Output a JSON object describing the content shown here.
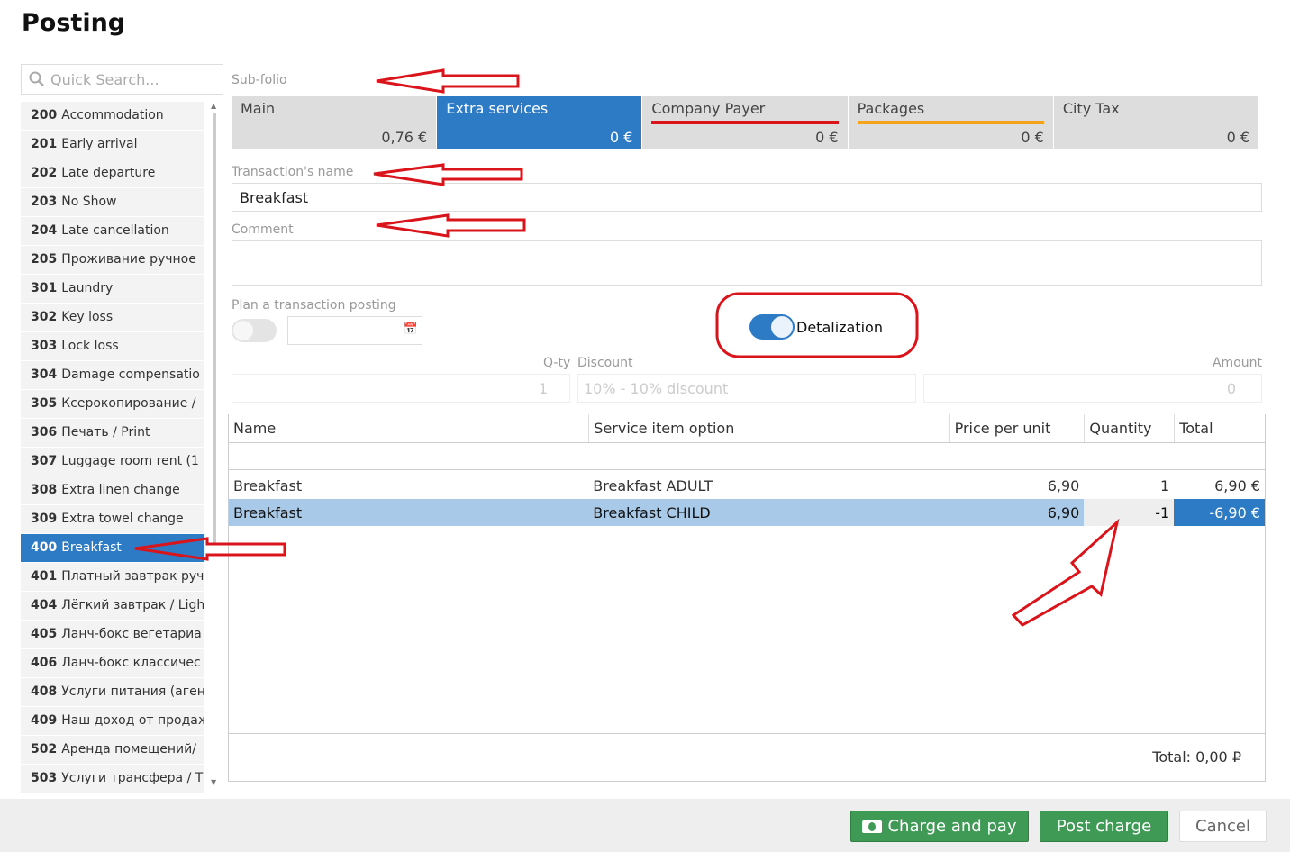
{
  "title": "Posting",
  "search": {
    "placeholder": "Quick Search..."
  },
  "services": [
    {
      "code": "200",
      "name": "Accommodation"
    },
    {
      "code": "201",
      "name": "Early arrival"
    },
    {
      "code": "202",
      "name": "Late departure"
    },
    {
      "code": "203",
      "name": "No Show"
    },
    {
      "code": "204",
      "name": "Late cancellation"
    },
    {
      "code": "205",
      "name": "Проживание ручное"
    },
    {
      "code": "301",
      "name": "Laundry"
    },
    {
      "code": "302",
      "name": "Key loss"
    },
    {
      "code": "303",
      "name": "Lock loss"
    },
    {
      "code": "304",
      "name": "Damage compensatio"
    },
    {
      "code": "305",
      "name": "Ксерокопирование /"
    },
    {
      "code": "306",
      "name": "Печать / Print"
    },
    {
      "code": "307",
      "name": "Luggage room rent (1"
    },
    {
      "code": "308",
      "name": "Extra linen change"
    },
    {
      "code": "309",
      "name": "Extra towel change"
    },
    {
      "code": "400",
      "name": "Breakfast",
      "selected": true
    },
    {
      "code": "401",
      "name": "Платный завтрак руч"
    },
    {
      "code": "404",
      "name": "Лёгкий завтрак / Ligh"
    },
    {
      "code": "405",
      "name": "Ланч-бокс вегетариа"
    },
    {
      "code": "406",
      "name": "Ланч-бокс классичес"
    },
    {
      "code": "408",
      "name": "Услуги питания (аген"
    },
    {
      "code": "409",
      "name": "Наш доход от продаж"
    },
    {
      "code": "502",
      "name": "Аренда помещений/"
    },
    {
      "code": "503",
      "name": "Услуги трансфера / Тр"
    }
  ],
  "subfolio": {
    "label": "Sub-folio",
    "tabs": [
      {
        "name": "Main",
        "value": "0,76 €"
      },
      {
        "name": "Extra services",
        "value": "0 €",
        "selected": true
      },
      {
        "name": "Company Payer",
        "value": "0 €",
        "underline": "#d9141b"
      },
      {
        "name": "Packages",
        "value": "0 €",
        "underline": "#f5a31a"
      },
      {
        "name": "City Tax",
        "value": "0 €"
      }
    ]
  },
  "transaction_name": {
    "label": "Transaction's name",
    "value": "Breakfast"
  },
  "comment": {
    "label": "Comment",
    "value": ""
  },
  "plan": {
    "label": "Plan a transaction posting",
    "enabled": false
  },
  "detalization": {
    "label": "Detalization",
    "enabled": true
  },
  "qty": {
    "label": "Q-ty",
    "value": "1"
  },
  "discount": {
    "label": "Discount",
    "placeholder": "10% - 10% discount"
  },
  "amount": {
    "label": "Amount",
    "value": "0"
  },
  "table": {
    "headers": [
      "Name",
      "Service item option",
      "Price per unit",
      "Quantity",
      "Total"
    ],
    "rows": [
      [
        "Breakfast",
        "Breakfast ADULT",
        "6,90",
        "1",
        "6,90 €"
      ],
      [
        "Breakfast",
        "Breakfast CHILD",
        "6,90",
        "-1",
        "-6,90 €"
      ]
    ],
    "total": "Total: 0,00 ₽"
  },
  "buttons": {
    "charge_pay": "Charge and pay",
    "post": "Post charge",
    "cancel": "Cancel"
  }
}
